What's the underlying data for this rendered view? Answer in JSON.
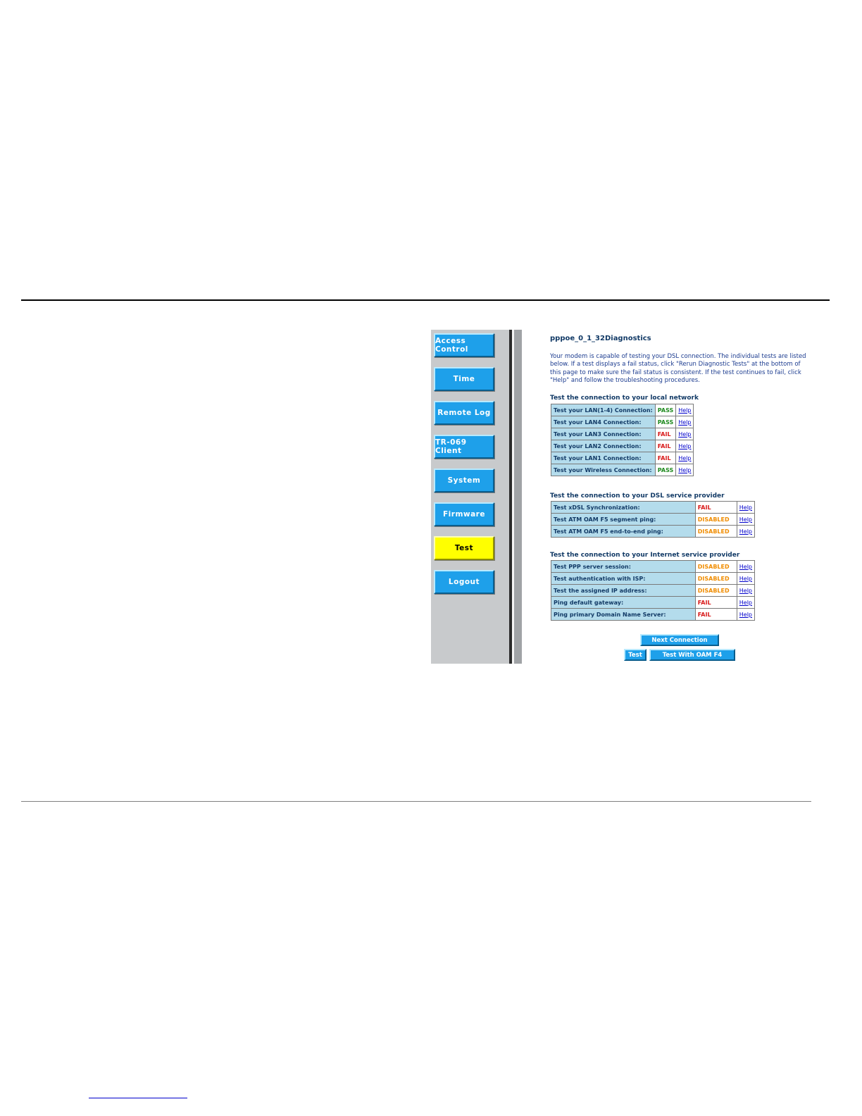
{
  "sidebar": {
    "items": [
      {
        "label": "Access Control",
        "active": false
      },
      {
        "label": "Time",
        "active": false
      },
      {
        "label": "Remote Log",
        "active": false
      },
      {
        "label": "TR-069 Client",
        "active": false
      },
      {
        "label": "System",
        "active": false
      },
      {
        "label": "Firmware",
        "active": false
      },
      {
        "label": "Test",
        "active": true
      },
      {
        "label": "Logout",
        "active": false
      }
    ]
  },
  "content": {
    "title": "pppoe_0_1_32Diagnostics",
    "intro": "Your modem is capable of testing your DSL connection. The individual tests are listed below. If a test displays a fail status, click \"Rerun Diagnostic Tests\" at the bottom of this page to make sure the fail status is consistent. If the test continues to fail, click \"Help\" and follow the troubleshooting procedures.",
    "sections": [
      {
        "title": "Test the connection to your local network",
        "rows": [
          {
            "label": "Test your LAN(1-4) Connection:",
            "status": "PASS",
            "help": "Help"
          },
          {
            "label": "Test your LAN4 Connection:",
            "status": "PASS",
            "help": "Help"
          },
          {
            "label": "Test your LAN3 Connection:",
            "status": "FAIL",
            "help": "Help"
          },
          {
            "label": "Test your LAN2 Connection:",
            "status": "FAIL",
            "help": "Help"
          },
          {
            "label": "Test your LAN1 Connection:",
            "status": "FAIL",
            "help": "Help"
          },
          {
            "label": "Test your Wireless Connection:",
            "status": "PASS",
            "help": "Help"
          }
        ]
      },
      {
        "title": "Test the connection to your DSL service provider",
        "rows": [
          {
            "label": "Test xDSL Synchronization:",
            "status": "FAIL",
            "help": "Help"
          },
          {
            "label": "Test ATM OAM F5 segment ping:",
            "status": "DISABLED",
            "help": "Help"
          },
          {
            "label": "Test ATM OAM F5 end-to-end ping:",
            "status": "DISABLED",
            "help": "Help"
          }
        ]
      },
      {
        "title": "Test the connection to your Internet service provider",
        "rows": [
          {
            "label": "Test PPP server session:",
            "status": "DISABLED",
            "help": "Help"
          },
          {
            "label": "Test authentication with ISP:",
            "status": "DISABLED",
            "help": "Help"
          },
          {
            "label": "Test the assigned IP address:",
            "status": "DISABLED",
            "help": "Help"
          },
          {
            "label": "Ping default gateway:",
            "status": "FAIL",
            "help": "Help"
          },
          {
            "label": "Ping primary Domain Name Server:",
            "status": "FAIL",
            "help": "Help"
          }
        ]
      }
    ],
    "buttons": {
      "next_connection": "Next Connection",
      "test": "Test",
      "test_oam_f4": "Test With OAM F4"
    }
  },
  "colors": {
    "button_blue": "#1ea0ea",
    "active_yellow": "#ffff00",
    "pass": "#1f8a1f",
    "fail": "#d81818",
    "disabled": "#f08c00",
    "label_cell": "#b4dcec"
  }
}
